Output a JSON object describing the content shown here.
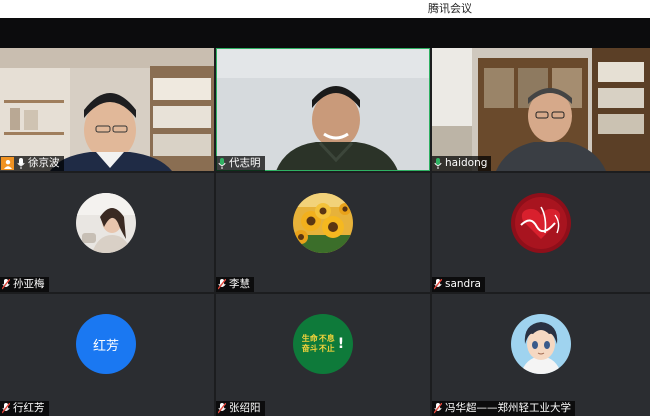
{
  "window": {
    "title": "腾讯会议"
  },
  "participants": [
    {
      "name": "徐京波",
      "role_badge": "host",
      "mic": "on",
      "display": "video"
    },
    {
      "name": "代志明",
      "mic": "on",
      "display": "video",
      "speaking": true
    },
    {
      "name": "haidong",
      "mic": "on",
      "display": "video"
    },
    {
      "name": "孙亚梅",
      "mic": "muted",
      "display": "avatar",
      "avatar": "photo-girl"
    },
    {
      "name": "李慧",
      "mic": "muted",
      "display": "avatar",
      "avatar": "sunflowers"
    },
    {
      "name": "sandra",
      "mic": "muted",
      "display": "avatar",
      "avatar": "red-heart-sign"
    },
    {
      "name": "行红芳",
      "mic": "muted",
      "display": "avatar",
      "avatar_text": "红芳",
      "avatar_color": "#1a78f2"
    },
    {
      "name": "张绍阳",
      "mic": "muted",
      "display": "avatar",
      "avatar_lines": [
        "生命",
        "奋斗",
        "不息",
        "不止"
      ],
      "avatar_mark": "!",
      "avatar_color": "#0e7a3a"
    },
    {
      "name": "冯华超——郑州轻工业大学",
      "mic": "muted",
      "display": "avatar",
      "avatar": "anime-boy"
    }
  ],
  "colors": {
    "speaking_outline": "#2fb163",
    "host_badge": "#f09222",
    "mic_on": "#2fb163",
    "mic_muted": "#e0453a"
  }
}
